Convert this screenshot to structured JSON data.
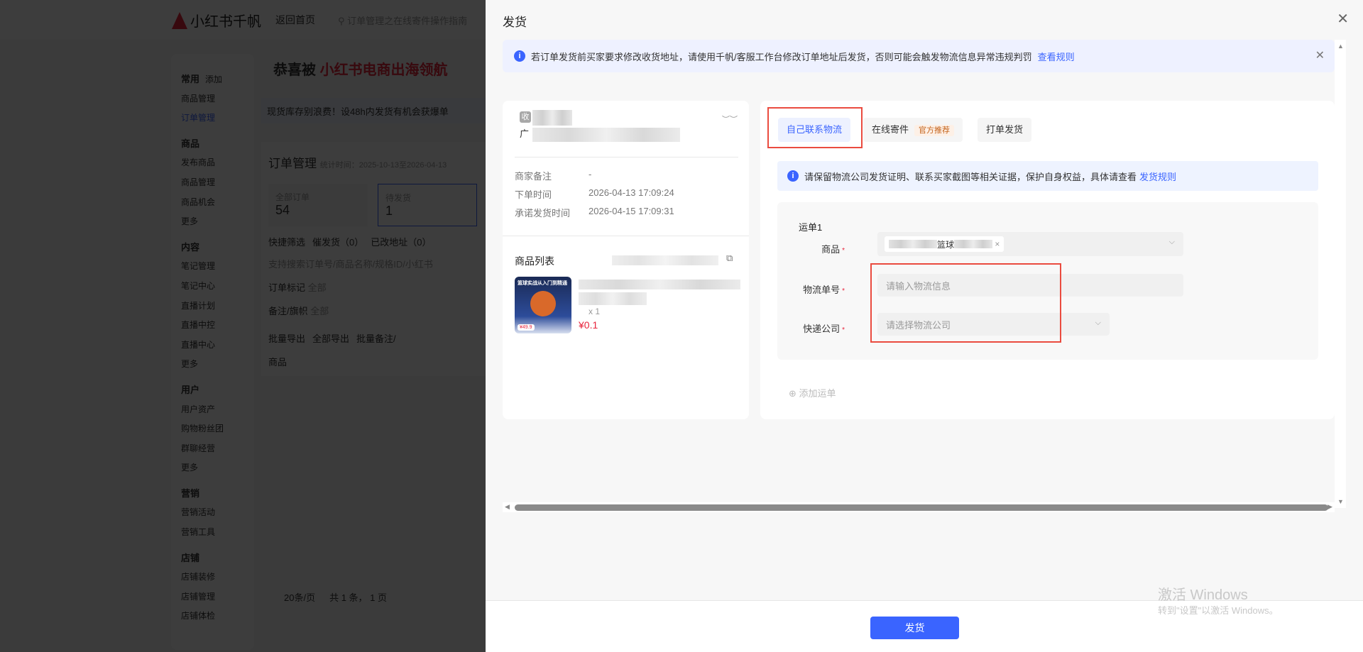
{
  "bg": {
    "logo": "小红书千帆",
    "back_home": "返回首页",
    "search_placeholder": "订单管理之在线寄件操作指南",
    "sidebar": [
      {
        "label": "常用",
        "group": true,
        "extra": "添加"
      },
      {
        "label": "商品管理"
      },
      {
        "label": "订单管理",
        "active": true
      },
      {
        "label": "商品",
        "group": true
      },
      {
        "label": "发布商品"
      },
      {
        "label": "商品管理"
      },
      {
        "label": "商品机会"
      },
      {
        "label": "更多"
      },
      {
        "label": "内容",
        "group": true
      },
      {
        "label": "笔记管理"
      },
      {
        "label": "笔记中心"
      },
      {
        "label": "直播计划"
      },
      {
        "label": "直播中控"
      },
      {
        "label": "直播中心"
      },
      {
        "label": "更多"
      },
      {
        "label": "用户",
        "group": true
      },
      {
        "label": "用户资产"
      },
      {
        "label": "购物粉丝团"
      },
      {
        "label": "群聊经营"
      },
      {
        "label": "更多"
      },
      {
        "label": "营销",
        "group": true
      },
      {
        "label": "营销活动"
      },
      {
        "label": "营销工具"
      },
      {
        "label": "店铺",
        "group": true
      },
      {
        "label": "店铺装修"
      },
      {
        "label": "店铺管理"
      },
      {
        "label": "店铺体检"
      }
    ],
    "banner_prefix": "恭喜被",
    "banner_highlight": "小红书电商出海领航",
    "notice": "现货库存别浪费！设48h内发货有机会获爆单",
    "page_title": "订单管理",
    "stat_time": "统计时间：2025-10-13至2026-04-13",
    "stats": [
      {
        "label": "全部订单",
        "value": "54"
      },
      {
        "label": "待发货",
        "value": "1"
      }
    ],
    "quick_filter": "快捷筛选",
    "filters": [
      "催发货（0）",
      "已改地址（0）"
    ],
    "search_placeholder2": "支持搜索订单号/商品名称/规格ID/小红书",
    "order_mark": "订单标记",
    "order_mark_val": "全部",
    "remark": "备注/旗帜",
    "remark_val": "全部",
    "actions": [
      "批量导出",
      "全部导出",
      "批量备注/"
    ],
    "col_product": "商品",
    "page_size": "20条/页",
    "total": "共 1 条， 1 页"
  },
  "drawer": {
    "title": "发货",
    "alert_text": "若订单发货前买家要求修改收货地址，请使用千帆/客服工作台修改订单地址后发货，否则可能会触发物流信息异常违规判罚",
    "alert_link": "查看规则",
    "order": {
      "recv_tag": "收",
      "addr_prefix": "广",
      "fields": [
        {
          "label": "商家备注",
          "value": "-"
        },
        {
          "label": "下单时间",
          "value": "2026-04-13 17:09:24"
        },
        {
          "label": "承诺发货时间",
          "value": "2026-04-15 17:09:31"
        }
      ],
      "product_list_label": "商品列表",
      "thumb_title": "篮球实战从入门到精通",
      "thumb_price": "¥49.9",
      "qty": "x 1",
      "price": "¥0.1"
    },
    "tabs": [
      {
        "label": "自己联系物流",
        "active": true
      },
      {
        "label": "在线寄件",
        "badge": "官方推荐"
      },
      {
        "label": "打单发货"
      }
    ],
    "tip": "请保留物流公司发货证明、联系买家截图等相关证据，保护自身权益，具体请查看",
    "tip_link": "发货规则",
    "waybill_title": "运单1",
    "product_label": "商品",
    "product_chip": "篮球",
    "tracking_label": "物流单号",
    "tracking_placeholder": "请输入物流信息",
    "courier_label": "快递公司",
    "courier_placeholder": "请选择物流公司",
    "add_waybill": "添加运单",
    "submit": "发货"
  },
  "watermark": {
    "line1": "激活 Windows",
    "line2": "转到\"设置\"以激活 Windows。"
  },
  "colors": {
    "accent": "#3a64ff",
    "danger": "#e8243c",
    "highlight": "#ea4b3f"
  }
}
